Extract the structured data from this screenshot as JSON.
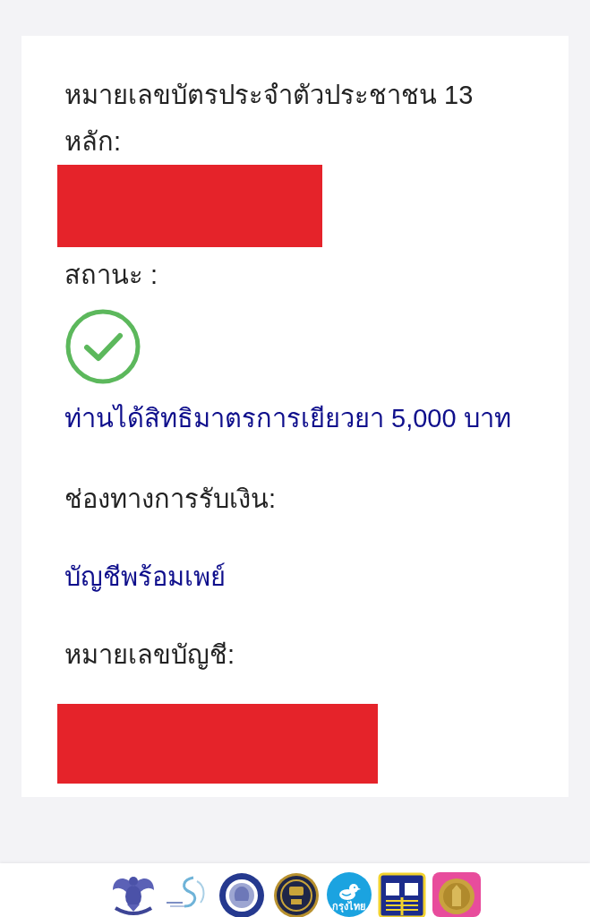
{
  "card": {
    "id_field": {
      "label": "หมายเลขบัตรประจำตัวประชาชน 13 หลัก:",
      "redacted": true
    },
    "status": {
      "label": "สถานะ :",
      "kind": "success",
      "message": "ท่านได้สิทธิมาตรการเยียวยา 5,000 บาท"
    },
    "channel": {
      "label": "ช่องทางการรับเงิน:",
      "value": "บัญชีพร้อมเพย์"
    },
    "account_field": {
      "label": "หมายเลขบัญชี:",
      "redacted": true
    }
  },
  "footer": {
    "logos": [
      {
        "kind": "bird"
      },
      {
        "kind": "swirl"
      },
      {
        "kind": "blue-seal"
      },
      {
        "kind": "gold-seal"
      },
      {
        "kind": "bank",
        "text": "กรุงไทย"
      },
      {
        "kind": "blue-square"
      },
      {
        "kind": "pink-square"
      }
    ]
  }
}
